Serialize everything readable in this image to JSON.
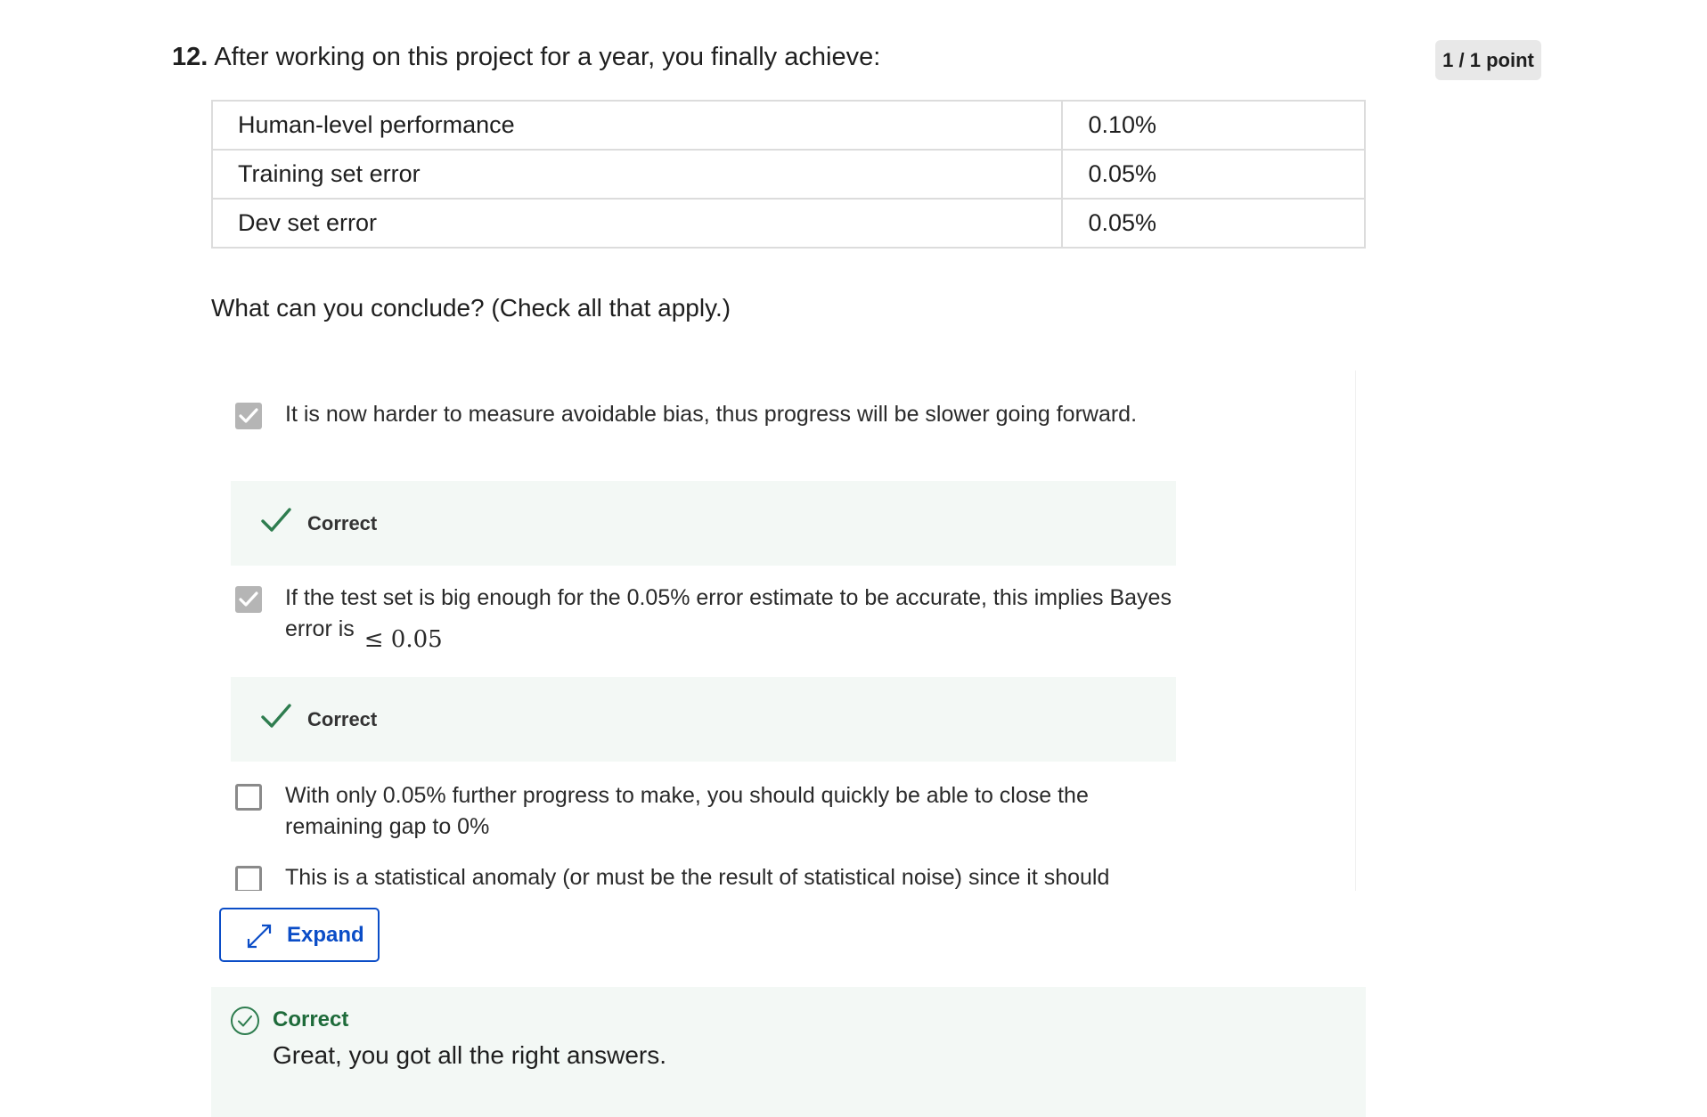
{
  "question": {
    "number": "12.",
    "text": "After working on this project for a year, you finally achieve:",
    "points": "1 / 1 point",
    "table": [
      {
        "label": "Human-level performance",
        "value": "0.10%"
      },
      {
        "label": "Training set error",
        "value": "0.05%"
      },
      {
        "label": "Dev set error",
        "value": "0.05%"
      }
    ],
    "prompt": "What can you conclude? (Check all that apply.)"
  },
  "options": [
    {
      "text": "It is now harder to measure avoidable bias, thus progress will be slower going forward.",
      "checked": true,
      "feedback": "Correct"
    },
    {
      "text": "If the test set is big enough for the 0.05% error estimate to be accurate, this implies Bayes error is",
      "math": "≤ 0.05",
      "checked": true,
      "feedback": "Correct"
    },
    {
      "text": "With only 0.05% further progress to make, you should quickly be able to close the remaining gap to 0%",
      "checked": false
    },
    {
      "text": "This is a statistical anomaly (or must be the result of statistical noise) since it should",
      "checked": false
    }
  ],
  "expand_button": {
    "label": "Expand",
    "icon": "expand-arrows-icon"
  },
  "result": {
    "title": "Correct",
    "message": "Great, you got all the right answers.",
    "icon": "check-circle-icon"
  },
  "colors": {
    "accent_blue": "#0b4dc7",
    "success_green": "#2e7d4f",
    "feedback_bg": "#f3f8f5",
    "badge_bg": "#e8e8e8",
    "checkbox_checked": "#b5b5b5"
  }
}
